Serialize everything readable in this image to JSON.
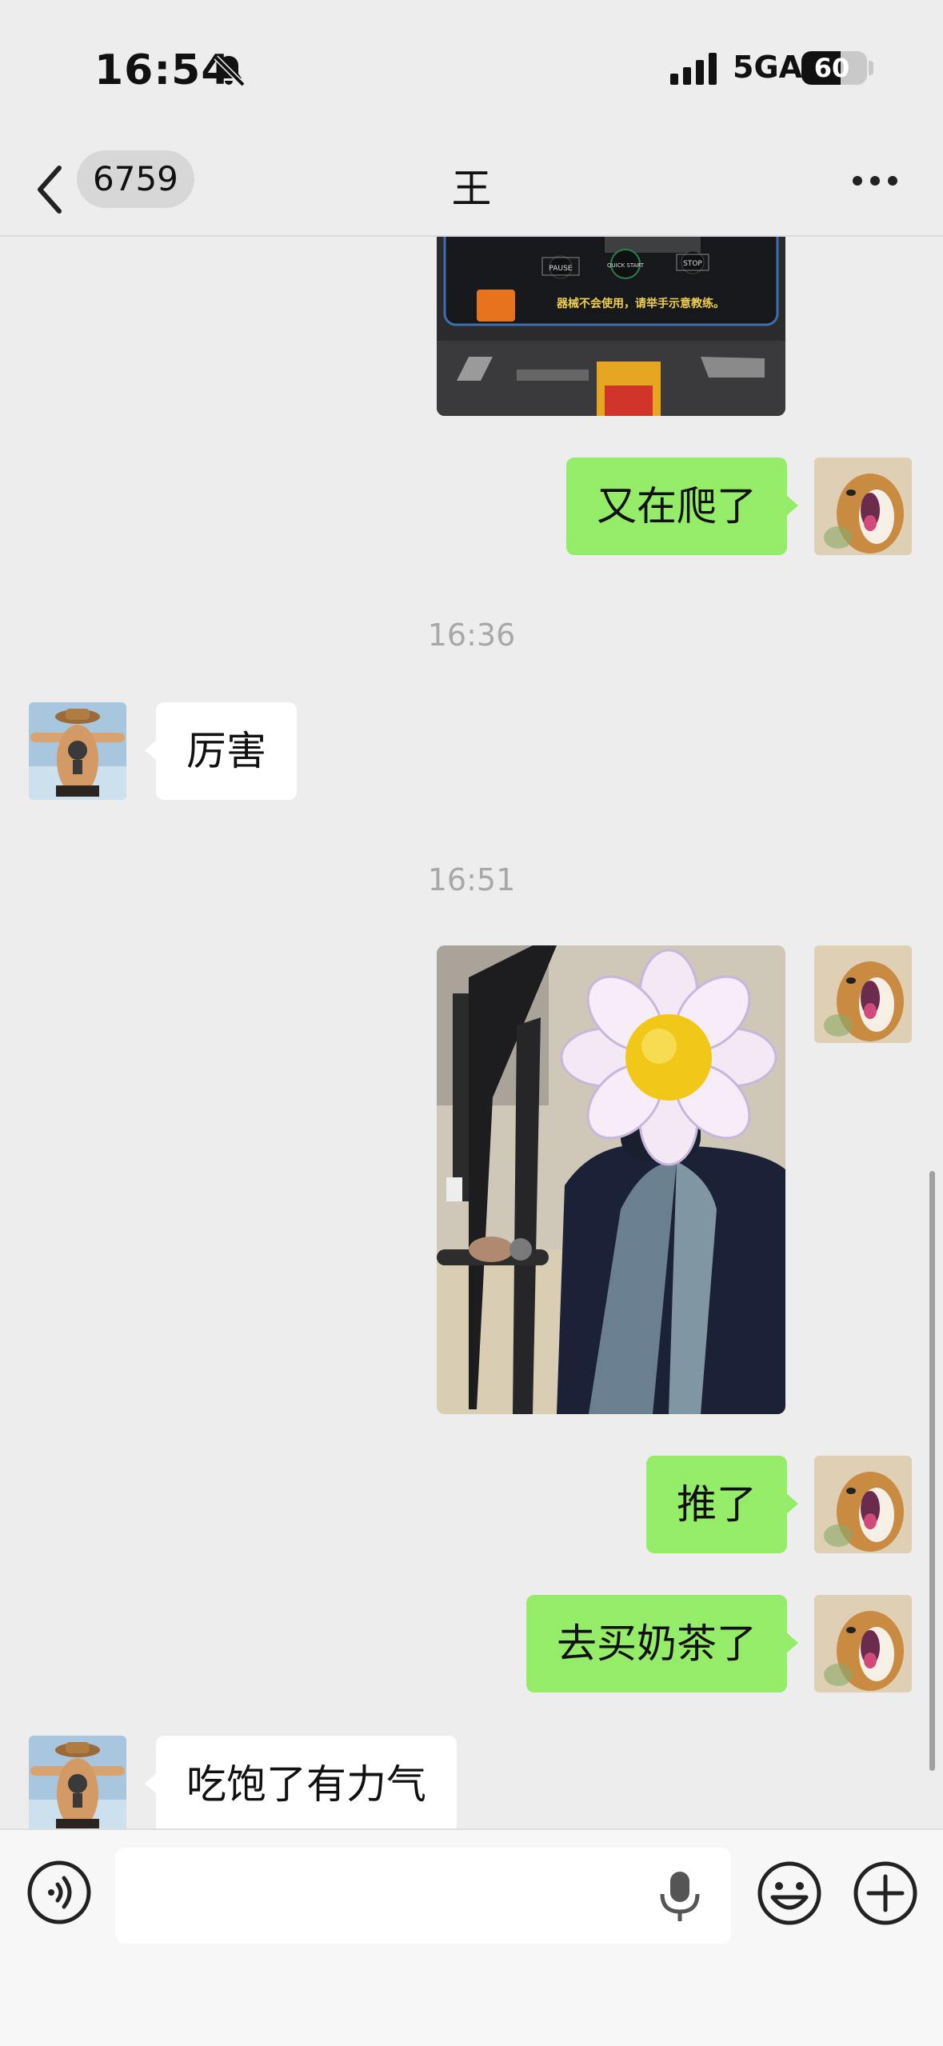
{
  "status": {
    "time": "16:54",
    "network": "5GA",
    "battery": "60",
    "battery_level": 0.6
  },
  "nav": {
    "unread_count": "6759",
    "title": "王"
  },
  "messages": {
    "m1_text": "又在爬了",
    "t1": "16:36",
    "m2_text": "厉害",
    "t2": "16:51",
    "m3_text": "推了",
    "m4_text": "去买奶茶了",
    "m5_text": "吃饱了有力气"
  },
  "treadmill_sign": {
    "pause": "PAUSE",
    "quick_start": "QUICK START",
    "stop": "STOP",
    "notice": "器械不会使用，请举手示意教练。"
  },
  "input": {
    "value": "",
    "placeholder": ""
  },
  "colors": {
    "outgoing_bubble": "#95ec69",
    "incoming_bubble": "#ffffff",
    "background": "#ededed"
  },
  "icons": [
    "bell-mute-icon",
    "signal-icon",
    "battery-icon",
    "back-icon",
    "more-icon",
    "voice-icon",
    "mic-icon",
    "emoji-icon",
    "plus-icon"
  ]
}
